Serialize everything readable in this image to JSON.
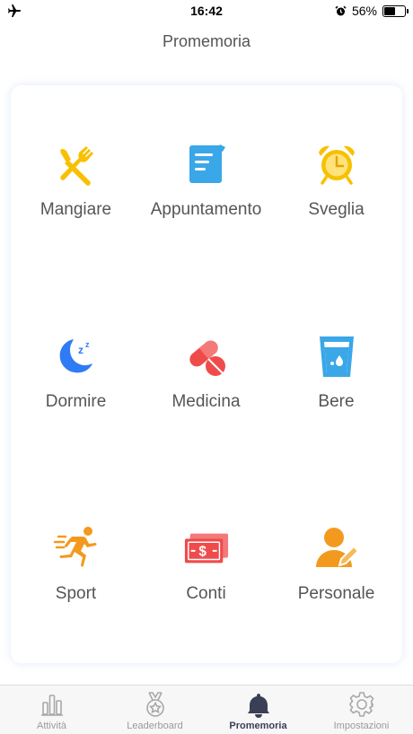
{
  "status": {
    "time": "16:42",
    "battery": "56%",
    "battery_level": 0.56
  },
  "header": {
    "title": "Promemoria"
  },
  "reminders": [
    {
      "label": "Mangiare",
      "icon": "fork-knife-icon",
      "color": "#F7C000"
    },
    {
      "label": "Appuntamento",
      "icon": "note-icon",
      "color": "#3AA7E8"
    },
    {
      "label": "Sveglia",
      "icon": "alarm-clock-icon",
      "color": "#F7C000"
    },
    {
      "label": "Dormire",
      "icon": "moon-sleep-icon",
      "color": "#2F7BF5"
    },
    {
      "label": "Medicina",
      "icon": "pill-icon",
      "color": "#F04B4B"
    },
    {
      "label": "Bere",
      "icon": "water-glass-icon",
      "color": "#3AA7E8"
    },
    {
      "label": "Sport",
      "icon": "running-icon",
      "color": "#F39A1E"
    },
    {
      "label": "Conti",
      "icon": "money-icon",
      "color": "#F04B4B"
    },
    {
      "label": "Personale",
      "icon": "person-edit-icon",
      "color": "#F39A1E"
    }
  ],
  "tabbar": {
    "tabs": [
      {
        "label": "Attività",
        "icon": "bar-chart-icon"
      },
      {
        "label": "Leaderboard",
        "icon": "medal-icon"
      },
      {
        "label": "Promemoria",
        "icon": "bell-icon",
        "active": true
      },
      {
        "label": "Impostazioni",
        "icon": "gear-icon"
      }
    ]
  }
}
